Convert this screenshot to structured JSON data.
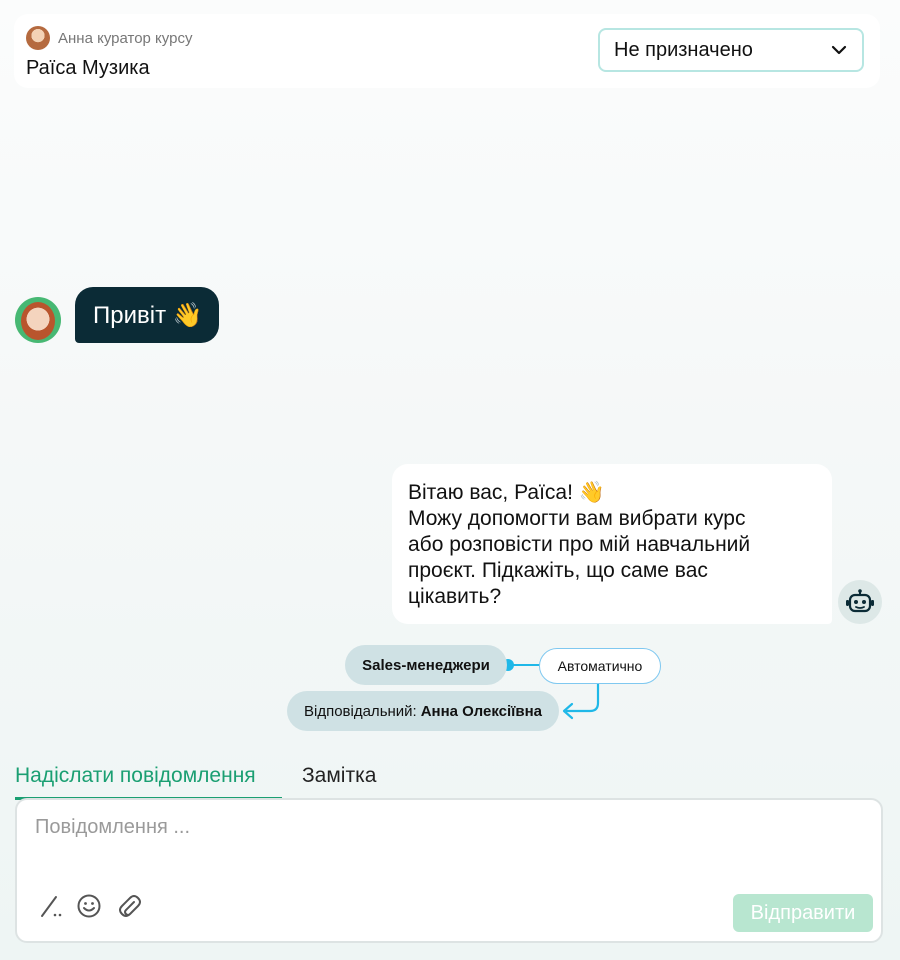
{
  "header": {
    "curator_label": "Анна куратор курсу",
    "client_name": "Раїса Музика",
    "assign_select_value": "Не призначено"
  },
  "chat": {
    "incoming_message": "Привіт 👋",
    "outgoing_message_lines": [
      "Вітаю вас, Раїса! 👋",
      "Можу допомогти вам вибрати курс",
      "або розповісти про мій навчальний",
      "проєкт. Підкажіть, що саме вас",
      "цікавить?"
    ]
  },
  "routing": {
    "group_label": "Sales-менеджери",
    "mode_label": "Автоматично",
    "responsible_prefix": "Відповідальний:",
    "responsible_name": "Анна Олексіївна"
  },
  "composer": {
    "tabs": [
      {
        "label": "Надіслати повідомлення",
        "active": true
      },
      {
        "label": "Замітка",
        "active": false
      }
    ],
    "placeholder": "Повідомлення ...",
    "send_label": "Відправити"
  },
  "icons": {
    "dropdown": "chevron-down-icon",
    "bot": "robot-icon",
    "slash": "slash-command-icon",
    "emoji": "emoji-icon",
    "attach": "paperclip-icon"
  },
  "colors": {
    "accent": "#1a9f72",
    "incoming_bubble": "#0b2b36",
    "select_border": "#b7e6e2",
    "flow_line": "#1fb8e8",
    "send_button": "#b8e6d0"
  }
}
